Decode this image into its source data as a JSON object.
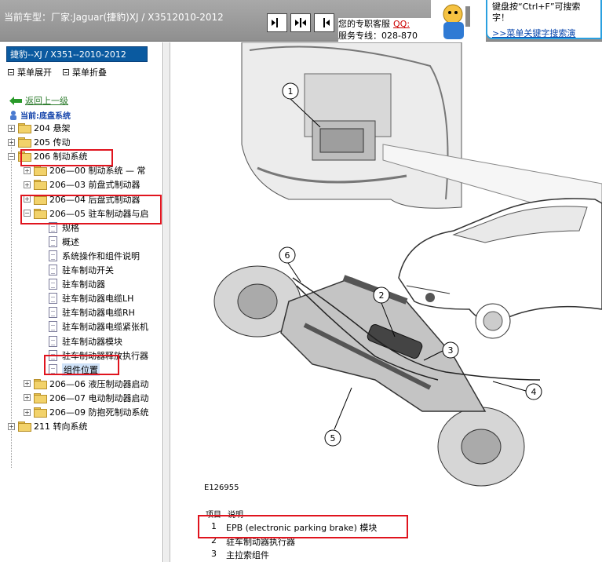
{
  "header": {
    "car_line": "当前车型：厂家:Jaguar(捷豹)XJ / X3512010-2012",
    "service_line1": "您的专职客服",
    "service_qq": "QQ:",
    "service_line2": "服务专线：028-870",
    "tip_text": "键盘按“Ctrl+F”可搜索字！",
    "tip_link": ">>菜单关键字搜索演"
  },
  "sidebar": {
    "model": "捷豹--XJ / X351--2010-2012",
    "expand": "菜单展开",
    "collapse": "菜单折叠",
    "back": "返回上一级",
    "current": "当前:底盘系统",
    "tree": [
      {
        "label": "204 悬架",
        "kind": "folder"
      },
      {
        "label": "205 传动",
        "kind": "folder"
      },
      {
        "label": "206 制动系统",
        "kind": "folder",
        "expanded": true
      },
      {
        "label": "206—00 制动系统 — 常",
        "kind": "folder"
      },
      {
        "label": "206—03 前盘式制动器",
        "kind": "folder"
      },
      {
        "label": "206—04 后盘式制动器",
        "kind": "folder"
      },
      {
        "label": "206—05 驻车制动器与启",
        "kind": "folder",
        "expanded": true
      },
      {
        "label": "规格",
        "kind": "doc"
      },
      {
        "label": "概述",
        "kind": "doc"
      },
      {
        "label": "系统操作和组件说明",
        "kind": "doc"
      },
      {
        "label": "驻车制动开关",
        "kind": "doc"
      },
      {
        "label": "驻车制动器",
        "kind": "doc"
      },
      {
        "label": "驻车制动器电缆LH",
        "kind": "doc"
      },
      {
        "label": "驻车制动器电缆RH",
        "kind": "doc"
      },
      {
        "label": "驻车制动器电缆紧张机",
        "kind": "doc"
      },
      {
        "label": "驻车制动器模块",
        "kind": "doc"
      },
      {
        "label": "驻车制动器释放执行器",
        "kind": "doc"
      },
      {
        "label": "组件位置",
        "kind": "doc",
        "selected": true
      },
      {
        "label": "206—06 液压制动器启动",
        "kind": "folder"
      },
      {
        "label": "206—07 电动制动器启动",
        "kind": "folder"
      },
      {
        "label": "206—09 防抱死制动系统",
        "kind": "folder"
      },
      {
        "label": "211 转向系统",
        "kind": "folder"
      }
    ]
  },
  "diagram": {
    "callouts": [
      "1",
      "2",
      "3",
      "4",
      "5",
      "6"
    ],
    "figure_id": "E126955",
    "legend_header_item": "项目",
    "legend_header_desc": "说明",
    "legend": [
      {
        "n": "1",
        "desc": "EPB (electronic parking brake) 模块"
      },
      {
        "n": "2",
        "desc": "驻车制动器执行器"
      },
      {
        "n": "3",
        "desc": "主拉索组件"
      }
    ]
  },
  "colors": {
    "highlight": "#e0141e",
    "model_bar": "#0a5aa0",
    "tip_border": "#2aa0e0"
  }
}
